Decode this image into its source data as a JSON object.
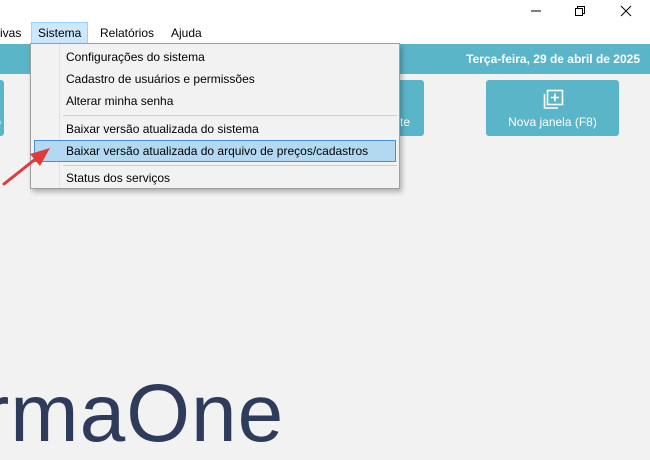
{
  "window_controls": {
    "minimize": "—",
    "maximize": "❐",
    "close": "✕"
  },
  "menubar": {
    "items": [
      "ivas",
      "Sistema",
      "Relatórios",
      "Ajuda"
    ],
    "active": "Sistema"
  },
  "header": {
    "date": "Terça-feira, 29 de abril de 2025"
  },
  "tiles": [
    {
      "label": "o"
    },
    {
      "label": "te"
    },
    {
      "label": "Nova janela (F8)",
      "icon": "new-window-icon"
    }
  ],
  "brand": {
    "text": "rmaOne"
  },
  "dropdown": {
    "items": [
      "Configurações do sistema",
      "Cadastro de usuários e permissões",
      "Alterar minha senha",
      "Baixar versão atualizada do sistema",
      "Baixar versão atualizada do arquivo de preços/cadastros",
      "Status dos serviços"
    ],
    "highlighted_index": 4
  },
  "colors": {
    "accent": "#5bb5c8",
    "brand": "#2e3b5b",
    "highlight": "#b3d9f2",
    "arrow": "#e03b3b"
  }
}
